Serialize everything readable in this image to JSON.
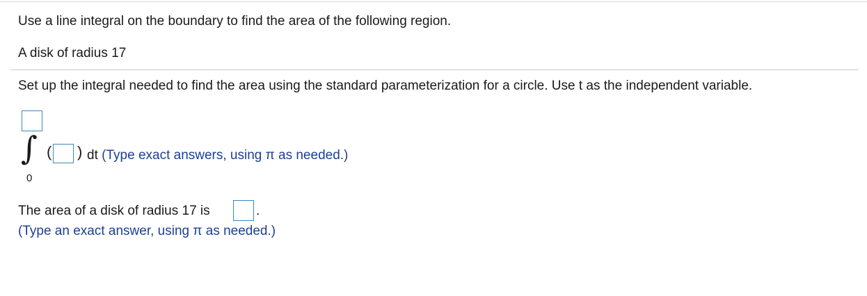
{
  "question": {
    "prompt": "Use a line integral on the boundary to find the area of the following region.",
    "region": "A disk of radius 17"
  },
  "part1": {
    "instruction": "Set up the integral needed to find the area using the standard parameterization for a circle. Use t as the independent variable.",
    "integral_symbol": "∫",
    "lower_limit": "0",
    "upper_limit_value": "",
    "integrand_value": "",
    "paren_open": "(",
    "paren_close": ")",
    "dt_label": "dt",
    "hint": "(Type exact answers, using π as needed.)"
  },
  "part2": {
    "label": "The area of a disk of radius 17 is",
    "answer_value": "",
    "period": ".",
    "hint": "(Type an exact answer, using π as needed.)"
  },
  "colors": {
    "input_border": "#3a87c8",
    "hint_text": "#1c3f94",
    "divider": "#cccccc"
  }
}
